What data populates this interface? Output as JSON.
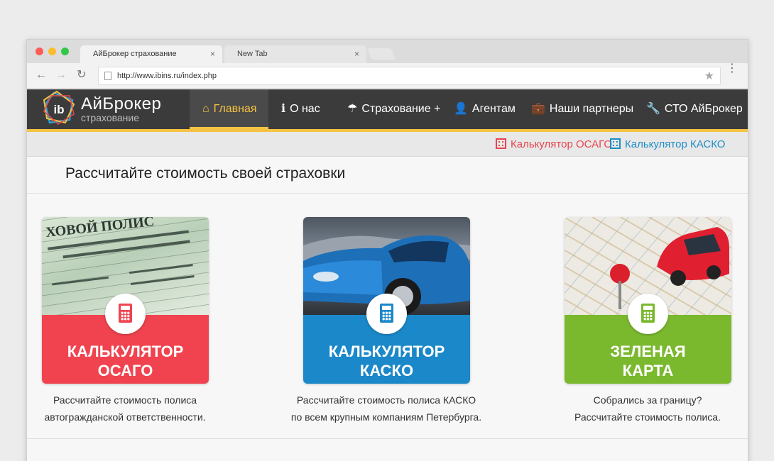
{
  "browser": {
    "tabs": [
      {
        "title": "АйБрокер страхование",
        "close": "×"
      },
      {
        "title": "New Tab",
        "close": "×"
      }
    ],
    "url": "http://www.ibins.ru/index.php",
    "back": "←",
    "forward": "→",
    "reload": "↻",
    "star": "★",
    "menu": "⋮"
  },
  "site": {
    "brand": "АйБрокер",
    "brand_sub": "страхование",
    "logo_letters": "ib",
    "nav": [
      {
        "label": "Главная",
        "icon": "home-icon",
        "glyph": "⌂"
      },
      {
        "label": "О нас",
        "icon": "info-icon",
        "glyph": "ℹ"
      },
      {
        "label": "Страхование +",
        "icon": "umbrella-icon",
        "glyph": "☂"
      },
      {
        "label": "Агентам",
        "icon": "user-icon",
        "glyph": "👤"
      },
      {
        "label": "Наши партнеры",
        "icon": "briefcase-icon",
        "glyph": "💼"
      },
      {
        "label": "СТО АйБрокер",
        "icon": "wrench-icon",
        "glyph": "🔧"
      }
    ],
    "subnav": [
      {
        "label": "Калькулятор ОСАГО",
        "color": "#e8454d"
      },
      {
        "label": "Калькулятор КАСКО",
        "color": "#1e8ec6"
      }
    ]
  },
  "main": {
    "title": "Рассчитайте стоимость своей страховки",
    "cards": [
      {
        "line1": "КАЛЬКУЛЯТОР",
        "line2": "ОСАГО",
        "color": "#f0434f",
        "image": "insurance-policy-image",
        "desc1": "Рассчитайте стоимость полиса",
        "desc2": "автогражданской ответственности."
      },
      {
        "line1": "КАЛЬКУЛЯТОР",
        "line2": "КАСКО",
        "color": "#1a88c9",
        "image": "blue-car-image",
        "desc1": "Рассчитайте стоимость полиса КАСКО",
        "desc2": "по всем крупным компаниям Петербурга."
      },
      {
        "line1": "ЗЕЛЕНАЯ",
        "line2": "КАРТА",
        "color": "#7ab82d",
        "image": "map-car-image",
        "desc1": "Собрались за границу?",
        "desc2": "Рассчитайте стоимость полиса."
      }
    ]
  }
}
